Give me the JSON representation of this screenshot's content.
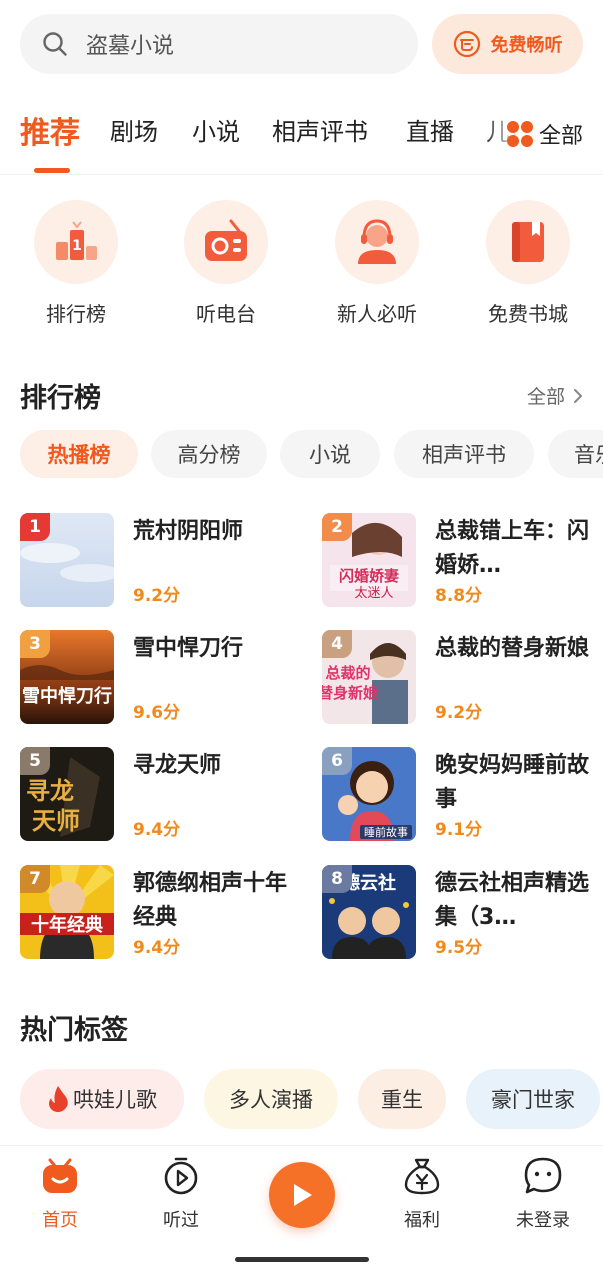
{
  "search": {
    "placeholder": "盗墓小说",
    "free_label": "免费畅听"
  },
  "tabs": {
    "items": [
      "推荐",
      "剧场",
      "小说",
      "相声评书",
      "直播",
      "儿童"
    ],
    "active": "推荐",
    "all_label": "全部"
  },
  "quick_entries": [
    {
      "label": "排行榜",
      "icon": "podium-icon"
    },
    {
      "label": "听电台",
      "icon": "radio-icon"
    },
    {
      "label": "新人必听",
      "icon": "headset-person-icon"
    },
    {
      "label": "免费书城",
      "icon": "book-icon"
    }
  ],
  "ranking": {
    "title": "排行榜",
    "more_label": "全部",
    "chips": [
      "热播榜",
      "高分榜",
      "小说",
      "相声评书",
      "音乐"
    ],
    "active_chip": "热播榜",
    "items": [
      {
        "rank": "1",
        "title": "荒村阴阳师",
        "score": "9.2分"
      },
      {
        "rank": "2",
        "title": "总裁错上车：闪婚娇…",
        "score": "8.8分"
      },
      {
        "rank": "3",
        "title": "雪中悍刀行",
        "score": "9.6分"
      },
      {
        "rank": "4",
        "title": "总裁的替身新娘",
        "score": "9.2分"
      },
      {
        "rank": "5",
        "title": "寻龙天师",
        "score": "9.4分"
      },
      {
        "rank": "6",
        "title": "晚安妈妈睡前故事",
        "score": "9.1分"
      },
      {
        "rank": "7",
        "title": "郭德纲相声十年经典",
        "score": "9.4分"
      },
      {
        "rank": "8",
        "title": "德云社相声精选集（3…",
        "score": "9.5分"
      }
    ]
  },
  "hot_tags": {
    "title": "热门标签",
    "items": [
      "哄娃儿歌",
      "多人演播",
      "重生",
      "豪门世家"
    ]
  },
  "bottom_nav": {
    "items": [
      {
        "label": "首页",
        "icon": "home-icon"
      },
      {
        "label": "听过",
        "icon": "history-icon"
      },
      {
        "label": "福利",
        "icon": "money-bag-icon"
      },
      {
        "label": "未登录",
        "icon": "chat-face-icon"
      }
    ],
    "active": "首页"
  },
  "colors": {
    "accent": "#f05a1e",
    "score": "#f08a1e",
    "chip_active_bg": "#fdeee6"
  }
}
